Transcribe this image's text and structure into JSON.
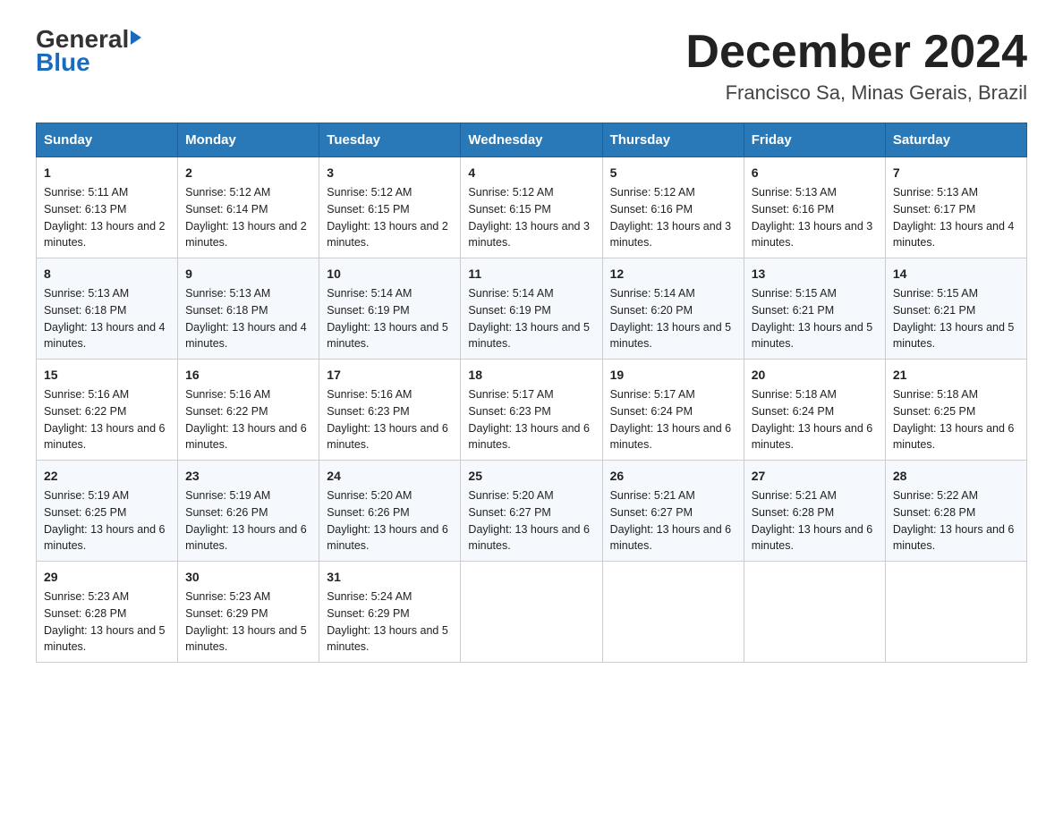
{
  "header": {
    "logo_general": "General",
    "logo_blue": "Blue",
    "month_title": "December 2024",
    "location": "Francisco Sa, Minas Gerais, Brazil"
  },
  "days_of_week": [
    "Sunday",
    "Monday",
    "Tuesday",
    "Wednesday",
    "Thursday",
    "Friday",
    "Saturday"
  ],
  "weeks": [
    [
      {
        "day": "1",
        "sunrise": "5:11 AM",
        "sunset": "6:13 PM",
        "daylight": "13 hours and 2 minutes."
      },
      {
        "day": "2",
        "sunrise": "5:12 AM",
        "sunset": "6:14 PM",
        "daylight": "13 hours and 2 minutes."
      },
      {
        "day": "3",
        "sunrise": "5:12 AM",
        "sunset": "6:15 PM",
        "daylight": "13 hours and 2 minutes."
      },
      {
        "day": "4",
        "sunrise": "5:12 AM",
        "sunset": "6:15 PM",
        "daylight": "13 hours and 3 minutes."
      },
      {
        "day": "5",
        "sunrise": "5:12 AM",
        "sunset": "6:16 PM",
        "daylight": "13 hours and 3 minutes."
      },
      {
        "day": "6",
        "sunrise": "5:13 AM",
        "sunset": "6:16 PM",
        "daylight": "13 hours and 3 minutes."
      },
      {
        "day": "7",
        "sunrise": "5:13 AM",
        "sunset": "6:17 PM",
        "daylight": "13 hours and 4 minutes."
      }
    ],
    [
      {
        "day": "8",
        "sunrise": "5:13 AM",
        "sunset": "6:18 PM",
        "daylight": "13 hours and 4 minutes."
      },
      {
        "day": "9",
        "sunrise": "5:13 AM",
        "sunset": "6:18 PM",
        "daylight": "13 hours and 4 minutes."
      },
      {
        "day": "10",
        "sunrise": "5:14 AM",
        "sunset": "6:19 PM",
        "daylight": "13 hours and 5 minutes."
      },
      {
        "day": "11",
        "sunrise": "5:14 AM",
        "sunset": "6:19 PM",
        "daylight": "13 hours and 5 minutes."
      },
      {
        "day": "12",
        "sunrise": "5:14 AM",
        "sunset": "6:20 PM",
        "daylight": "13 hours and 5 minutes."
      },
      {
        "day": "13",
        "sunrise": "5:15 AM",
        "sunset": "6:21 PM",
        "daylight": "13 hours and 5 minutes."
      },
      {
        "day": "14",
        "sunrise": "5:15 AM",
        "sunset": "6:21 PM",
        "daylight": "13 hours and 5 minutes."
      }
    ],
    [
      {
        "day": "15",
        "sunrise": "5:16 AM",
        "sunset": "6:22 PM",
        "daylight": "13 hours and 6 minutes."
      },
      {
        "day": "16",
        "sunrise": "5:16 AM",
        "sunset": "6:22 PM",
        "daylight": "13 hours and 6 minutes."
      },
      {
        "day": "17",
        "sunrise": "5:16 AM",
        "sunset": "6:23 PM",
        "daylight": "13 hours and 6 minutes."
      },
      {
        "day": "18",
        "sunrise": "5:17 AM",
        "sunset": "6:23 PM",
        "daylight": "13 hours and 6 minutes."
      },
      {
        "day": "19",
        "sunrise": "5:17 AM",
        "sunset": "6:24 PM",
        "daylight": "13 hours and 6 minutes."
      },
      {
        "day": "20",
        "sunrise": "5:18 AM",
        "sunset": "6:24 PM",
        "daylight": "13 hours and 6 minutes."
      },
      {
        "day": "21",
        "sunrise": "5:18 AM",
        "sunset": "6:25 PM",
        "daylight": "13 hours and 6 minutes."
      }
    ],
    [
      {
        "day": "22",
        "sunrise": "5:19 AM",
        "sunset": "6:25 PM",
        "daylight": "13 hours and 6 minutes."
      },
      {
        "day": "23",
        "sunrise": "5:19 AM",
        "sunset": "6:26 PM",
        "daylight": "13 hours and 6 minutes."
      },
      {
        "day": "24",
        "sunrise": "5:20 AM",
        "sunset": "6:26 PM",
        "daylight": "13 hours and 6 minutes."
      },
      {
        "day": "25",
        "sunrise": "5:20 AM",
        "sunset": "6:27 PM",
        "daylight": "13 hours and 6 minutes."
      },
      {
        "day": "26",
        "sunrise": "5:21 AM",
        "sunset": "6:27 PM",
        "daylight": "13 hours and 6 minutes."
      },
      {
        "day": "27",
        "sunrise": "5:21 AM",
        "sunset": "6:28 PM",
        "daylight": "13 hours and 6 minutes."
      },
      {
        "day": "28",
        "sunrise": "5:22 AM",
        "sunset": "6:28 PM",
        "daylight": "13 hours and 6 minutes."
      }
    ],
    [
      {
        "day": "29",
        "sunrise": "5:23 AM",
        "sunset": "6:28 PM",
        "daylight": "13 hours and 5 minutes."
      },
      {
        "day": "30",
        "sunrise": "5:23 AM",
        "sunset": "6:29 PM",
        "daylight": "13 hours and 5 minutes."
      },
      {
        "day": "31",
        "sunrise": "5:24 AM",
        "sunset": "6:29 PM",
        "daylight": "13 hours and 5 minutes."
      },
      null,
      null,
      null,
      null
    ]
  ],
  "labels": {
    "sunrise": "Sunrise:",
    "sunset": "Sunset:",
    "daylight": "Daylight:"
  }
}
